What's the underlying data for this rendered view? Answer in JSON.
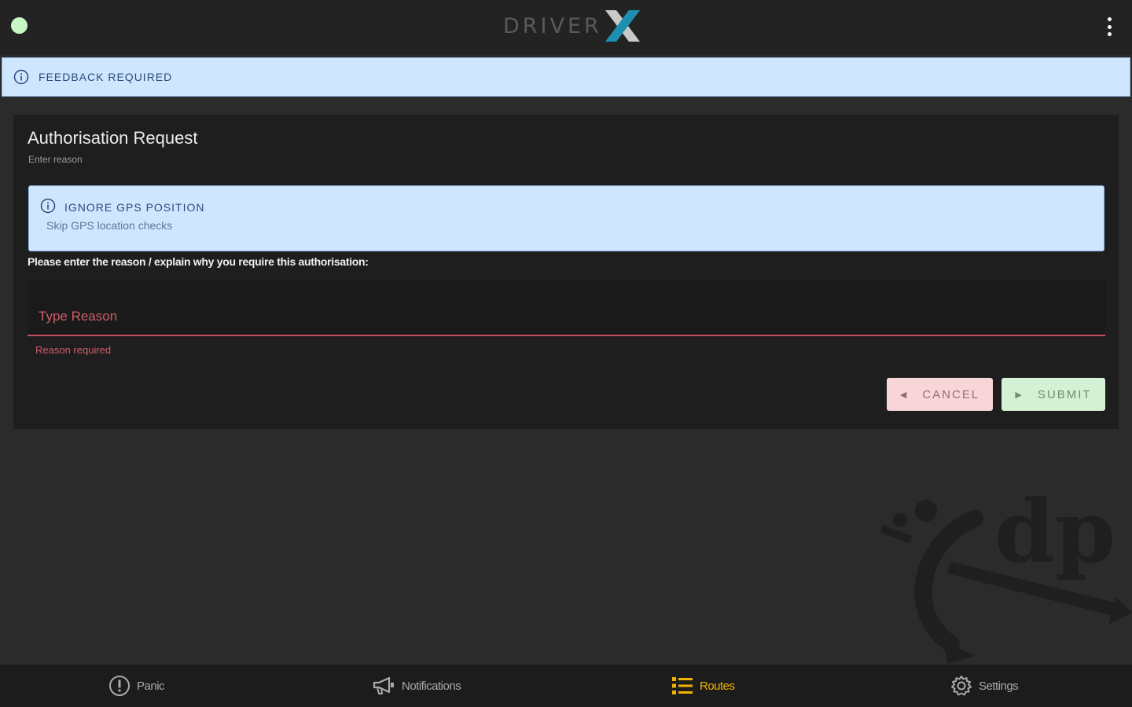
{
  "header": {
    "logo_text": "DRIVER",
    "status_color": "#c8f7c5"
  },
  "feedback_banner": {
    "text": "FEEDBACK REQUIRED"
  },
  "card": {
    "title": "Authorisation Request",
    "subtitle": "Enter reason",
    "option": {
      "title": "IGNORE GPS POSITION",
      "description": "Skip GPS location checks"
    },
    "prompt": "Please enter the reason / explain why you require this authorisation:",
    "reason_input": {
      "value": "",
      "placeholder": "Type Reason"
    },
    "error": "Reason required",
    "cancel_label": "CANCEL",
    "submit_label": "SUBMIT"
  },
  "bottom_nav": {
    "items": [
      {
        "label": "Panic",
        "icon": "panic-icon",
        "active": false
      },
      {
        "label": "Notifications",
        "icon": "megaphone-icon",
        "active": false
      },
      {
        "label": "Routes",
        "icon": "list-icon",
        "active": true
      },
      {
        "label": "Settings",
        "icon": "gear-icon",
        "active": false
      }
    ],
    "active_color": "#f0b400"
  }
}
